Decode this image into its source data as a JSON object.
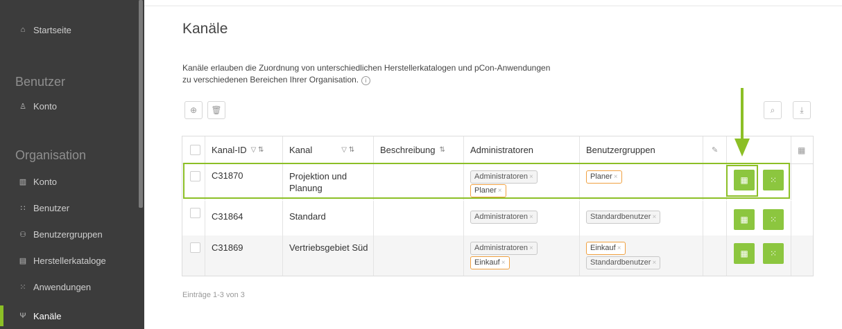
{
  "sidebar": {
    "items": [
      {
        "label": "Startseite",
        "icon": "home-icon"
      },
      {
        "label": "Konto",
        "icon": "user-icon"
      },
      {
        "label": "Konto",
        "icon": "building-icon"
      },
      {
        "label": "Benutzer",
        "icon": "users-icon"
      },
      {
        "label": "Benutzergruppen",
        "icon": "user-group-icon"
      },
      {
        "label": "Herstellerkataloge",
        "icon": "catalog-icon"
      },
      {
        "label": "Anwendungen",
        "icon": "apps-grid-icon"
      },
      {
        "label": "Kanäle",
        "icon": "channel-icon"
      }
    ],
    "sections": {
      "benutzer": "Benutzer",
      "organisation": "Organisation"
    }
  },
  "main": {
    "title": "Kanäle",
    "description": "Kanäle erlauben die Zuordnung von unterschiedlichen Herstellerkatalogen und pCon-Anwendungen zu verschiedenen Bereichen Ihrer Organisation.",
    "info_glyph": "i",
    "footer": "Einträge 1-3 von 3"
  },
  "table": {
    "headers": {
      "id": "Kanal-ID",
      "kanal": "Kanal",
      "beschreibung": "Beschreibung",
      "admins": "Administratoren",
      "groups": "Benutzergruppen"
    },
    "rows": [
      {
        "id": "C31870",
        "kanal": "Projektion und Planung",
        "beschreibung": "",
        "admins": [
          "Administratoren",
          "Planer"
        ],
        "groups": [
          "Planer"
        ]
      },
      {
        "id": "C31864",
        "kanal": "Standard",
        "beschreibung": "",
        "admins": [
          "Administratoren"
        ],
        "groups": [
          "Standardbenutzer"
        ]
      },
      {
        "id": "C31869",
        "kanal": "Vertriebsgebiet Süd",
        "beschreibung": "",
        "admins": [
          "Administratoren",
          "Einkauf"
        ],
        "groups": [
          "Einkauf",
          "Standardbenutzer"
        ]
      }
    ]
  },
  "colors": {
    "accent": "#8cbf26",
    "sidebar_bg": "#3c3c3c",
    "tag_orange": "#f0a040"
  }
}
